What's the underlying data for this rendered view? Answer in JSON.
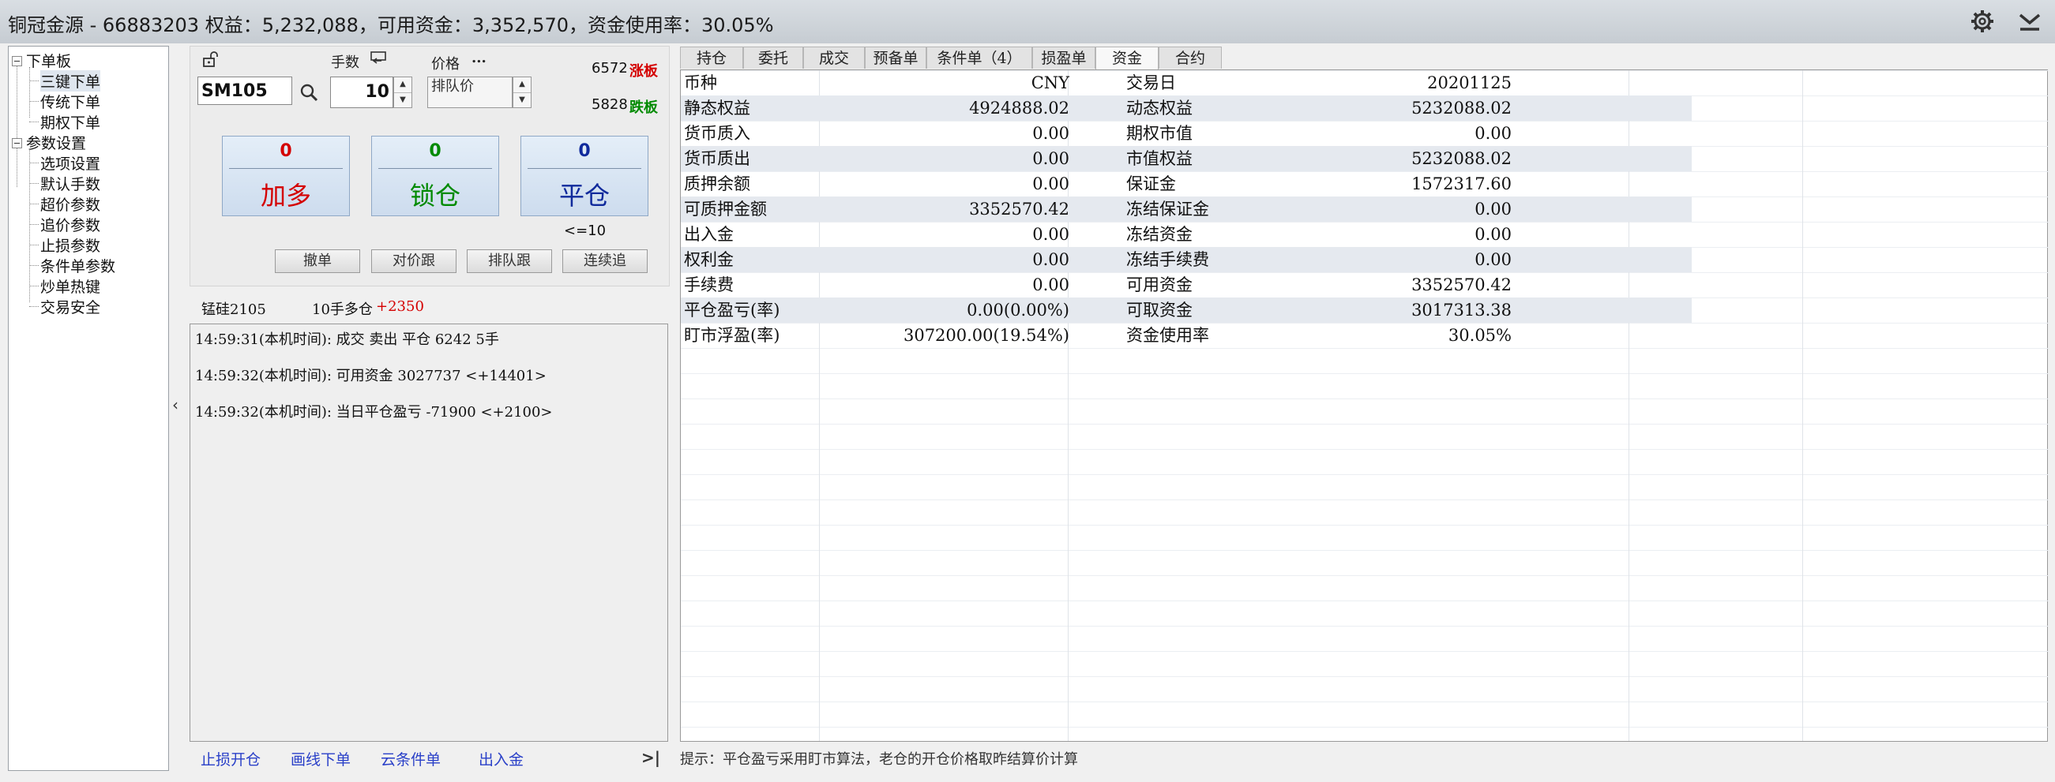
{
  "titlebar": {
    "title": "铜冠金源 - 66883203  权益：5,232,088，可用资金：3,352,570，资金使用率：30.05%",
    "icons": [
      "gear-icon",
      "chevron-down-icon"
    ]
  },
  "tree": {
    "groups": [
      {
        "label": "下单板",
        "items": [
          "三键下单",
          "传统下单",
          "期权下单"
        ]
      },
      {
        "label": "参数设置",
        "items": [
          "选项设置",
          "默认手数",
          "超价参数",
          "追价参数",
          "止损参数",
          "条件单参数",
          "炒单热键",
          "交易安全"
        ]
      }
    ],
    "selected": "三键下单"
  },
  "order": {
    "qty_label": "手数",
    "price_label": "价格",
    "price_dots": "...",
    "code": "SM105",
    "qty": "10",
    "price_mode": "排队价",
    "limit_up_price": "6572",
    "limit_up_label": "涨板",
    "limit_down_price": "5828",
    "limit_down_label": "跌板",
    "buttons": [
      {
        "count": "0",
        "label": "加多",
        "color": "#d40000"
      },
      {
        "count": "0",
        "label": "锁仓",
        "color": "#008a00"
      },
      {
        "count": "0",
        "label": "平仓",
        "color": "#102a9c"
      }
    ],
    "limit_note": "<=10",
    "small_buttons": [
      "撤单",
      "对价跟",
      "排队跟",
      "连续追"
    ]
  },
  "position": {
    "name": "锰硅2105",
    "desc": "10手多仓",
    "pnl": "+2350"
  },
  "log": [
    "14:59:31(本机时间): 成交  卖出  平仓  6242  5手",
    "14:59:32(本机时间): 可用资金 3027737  <+14401>",
    "14:59:32(本机时间): 当日平仓盈亏 -71900  <+2100>"
  ],
  "bottom_links": [
    "止损开仓",
    "画线下单",
    "云条件单",
    "出入金"
  ],
  "page_button": ">|",
  "collapse": "‹",
  "tabs": [
    "持仓",
    "委托",
    "成交",
    "预备单",
    "条件单（4）",
    "损盈单",
    "资金",
    "合约"
  ],
  "active_tab": "资金",
  "fund_rows": [
    {
      "l1": "币种",
      "v1": "CNY",
      "l2": "交易日",
      "v2": "20201125"
    },
    {
      "l1": "静态权益",
      "v1": "4924888.02",
      "l2": "动态权益",
      "v2": "5232088.02"
    },
    {
      "l1": "货币质入",
      "v1": "0.00",
      "l2": "期权市值",
      "v2": "0.00"
    },
    {
      "l1": "货币质出",
      "v1": "0.00",
      "l2": "市值权益",
      "v2": "5232088.02"
    },
    {
      "l1": "质押余额",
      "v1": "0.00",
      "l2": "保证金",
      "v2": "1572317.60"
    },
    {
      "l1": "可质押金额",
      "v1": "3352570.42",
      "l2": "冻结保证金",
      "v2": "0.00"
    },
    {
      "l1": "出入金",
      "v1": "0.00",
      "l2": "冻结资金",
      "v2": "0.00"
    },
    {
      "l1": "权利金",
      "v1": "0.00",
      "l2": "冻结手续费",
      "v2": "0.00"
    },
    {
      "l1": "手续费",
      "v1": "0.00",
      "l2": "可用资金",
      "v2": "3352570.42"
    },
    {
      "l1": "平仓盈亏(率)",
      "v1": "0.00(0.00%)",
      "l2": "可取资金",
      "v2": "3017313.38"
    },
    {
      "l1": "盯市浮盈(率)",
      "v1": "307200.00(19.54%)",
      "l2": "资金使用率",
      "v2": "30.05%"
    }
  ],
  "hint": "提示：平仓盈亏采用盯市算法，老仓的开仓价格取昨结算价计算",
  "colors": {
    "limit_up": "#d40000",
    "limit_down": "#008a00",
    "link": "#2a40c8",
    "pnl": "#d40000"
  }
}
